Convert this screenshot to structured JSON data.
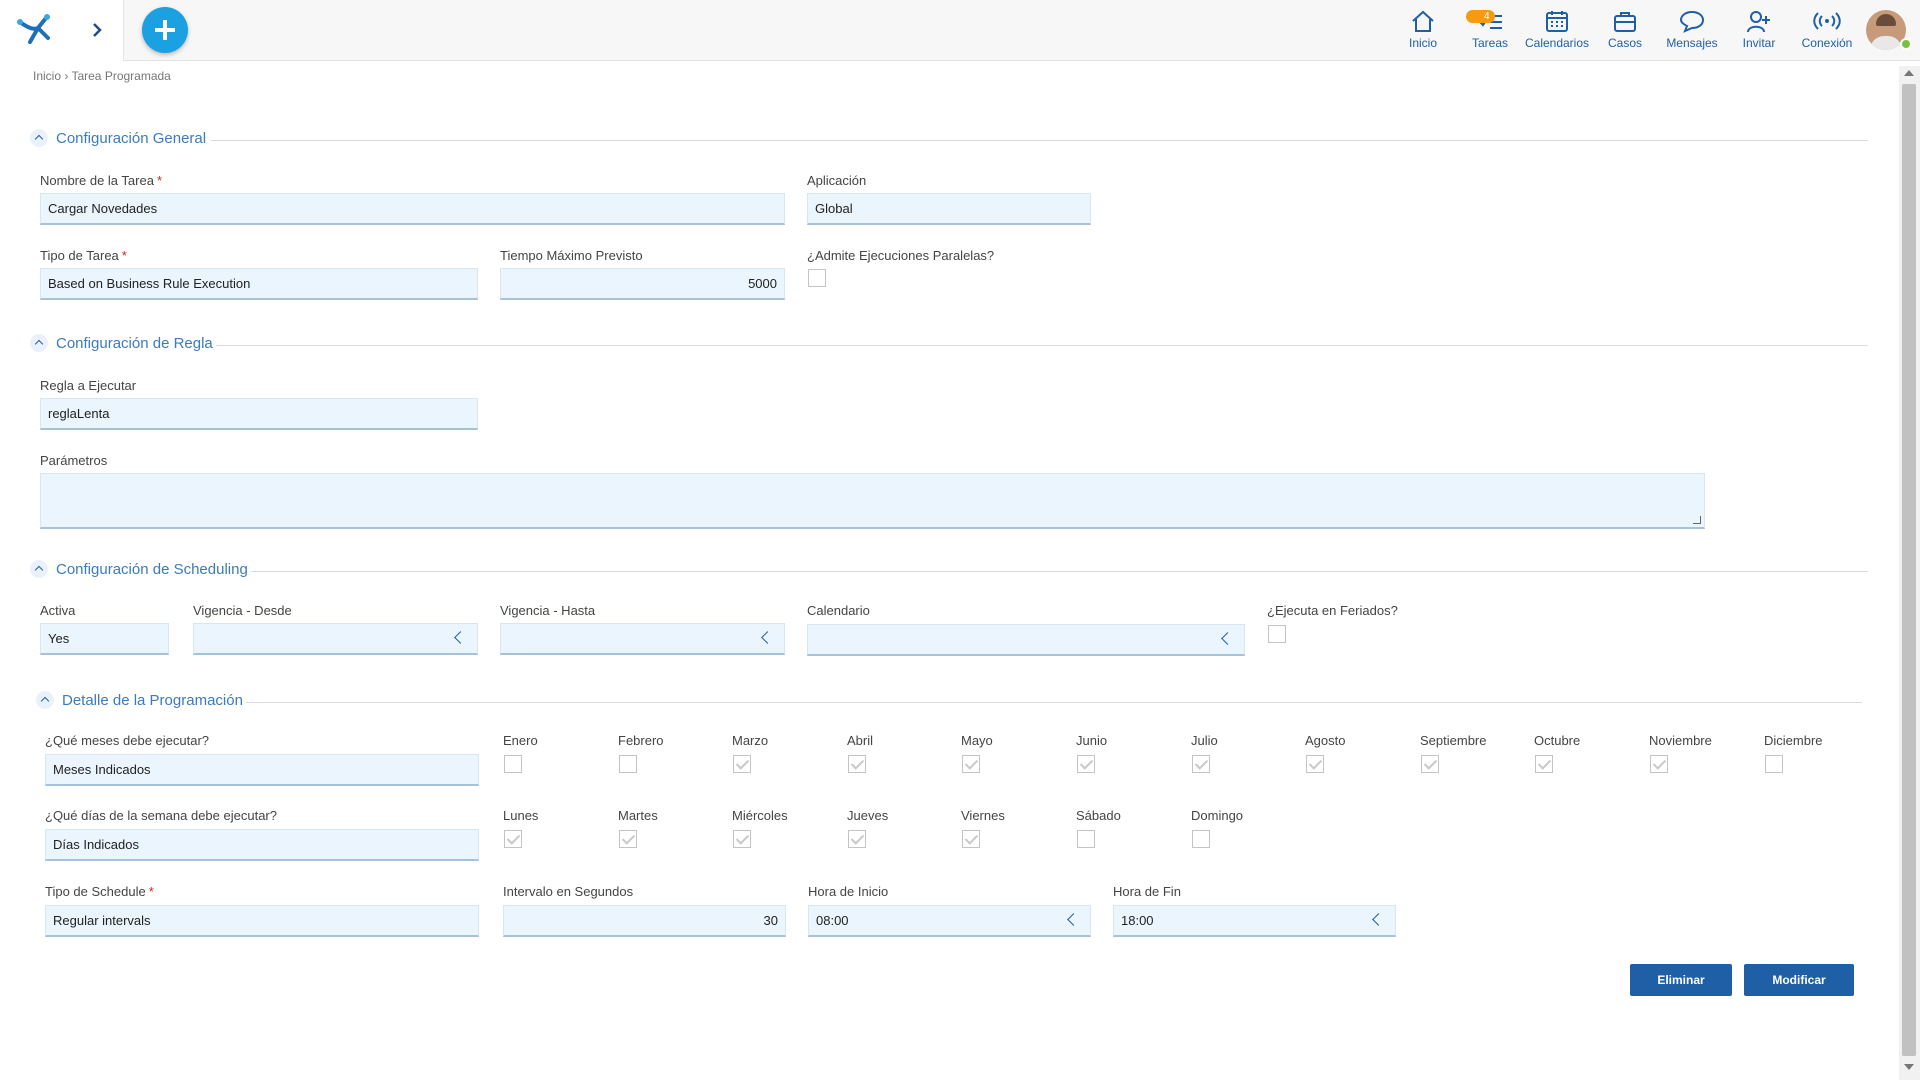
{
  "header": {
    "nav": [
      {
        "id": "inicio",
        "label": "Inicio",
        "icon": "home-icon"
      },
      {
        "id": "tareas",
        "label": "Tareas",
        "icon": "tasks-icon",
        "badge": "4"
      },
      {
        "id": "calendarios",
        "label": "Calendarios",
        "icon": "calendar-icon"
      },
      {
        "id": "casos",
        "label": "Casos",
        "icon": "briefcase-icon"
      },
      {
        "id": "mensajes",
        "label": "Mensajes",
        "icon": "chat-icon"
      },
      {
        "id": "invitar",
        "label": "Invitar",
        "icon": "invite-user-icon"
      },
      {
        "id": "conexion",
        "label": "Conexión",
        "icon": "connection-icon"
      }
    ],
    "colors": {
      "accent": "#1ba0e2",
      "nav_blue": "#1f5fa6",
      "badge": "#f39c12",
      "online": "#7ac142"
    }
  },
  "breadcrumb": "Inicio › Tarea Programada",
  "sections": {
    "general": "Configuración General",
    "regla": "Configuración de Regla",
    "scheduling": "Configuración de Scheduling",
    "detalle": "Detalle de la Programación"
  },
  "general": {
    "nombre_label": "Nombre de la Tarea",
    "nombre_value": "Cargar Novedades",
    "aplicacion_label": "Aplicación",
    "aplicacion_value": "Global",
    "tipo_label": "Tipo de Tarea",
    "tipo_value": "Based on Business Rule Execution",
    "tiempo_label": "Tiempo Máximo Previsto",
    "tiempo_value": "5000",
    "paralelas_label": "¿Admite Ejecuciones Paralelas?",
    "paralelas_checked": false
  },
  "regla": {
    "regla_label": "Regla a Ejecutar",
    "regla_value": "reglaLenta",
    "parametros_label": "Parámetros",
    "parametros_value": ""
  },
  "scheduling": {
    "activa_label": "Activa",
    "activa_value": "Yes",
    "desde_label": "Vigencia - Desde",
    "desde_value": "",
    "hasta_label": "Vigencia - Hasta",
    "hasta_value": "",
    "calendario_label": "Calendario",
    "calendario_value": "",
    "feriados_label": "¿Ejecuta en Feriados?",
    "feriados_checked": false
  },
  "detalle": {
    "meses_label": "¿Qué meses debe ejecutar?",
    "meses_value": "Meses Indicados",
    "months": [
      {
        "label": "Enero",
        "checked": false
      },
      {
        "label": "Febrero",
        "checked": false
      },
      {
        "label": "Marzo",
        "checked": true
      },
      {
        "label": "Abril",
        "checked": true
      },
      {
        "label": "Mayo",
        "checked": true
      },
      {
        "label": "Junio",
        "checked": true
      },
      {
        "label": "Julio",
        "checked": true
      },
      {
        "label": "Agosto",
        "checked": true
      },
      {
        "label": "Septiembre",
        "checked": true
      },
      {
        "label": "Octubre",
        "checked": true
      },
      {
        "label": "Noviembre",
        "checked": true
      },
      {
        "label": "Diciembre",
        "checked": false
      }
    ],
    "dias_label": "¿Qué días de la semana debe ejecutar?",
    "dias_value": "Días Indicados",
    "days": [
      {
        "label": "Lunes",
        "checked": true
      },
      {
        "label": "Martes",
        "checked": true
      },
      {
        "label": "Miércoles",
        "checked": true
      },
      {
        "label": "Jueves",
        "checked": true
      },
      {
        "label": "Viernes",
        "checked": true
      },
      {
        "label": "Sábado",
        "checked": false
      },
      {
        "label": "Domingo",
        "checked": false
      }
    ],
    "schedule_label": "Tipo de Schedule",
    "schedule_value": "Regular intervals",
    "intervalo_label": "Intervalo en Segundos",
    "intervalo_value": "30",
    "inicio_label": "Hora de Inicio",
    "inicio_value": "08:00",
    "fin_label": "Hora de Fin",
    "fin_value": "18:00"
  },
  "actions": {
    "eliminar": "Eliminar",
    "modificar": "Modificar"
  }
}
